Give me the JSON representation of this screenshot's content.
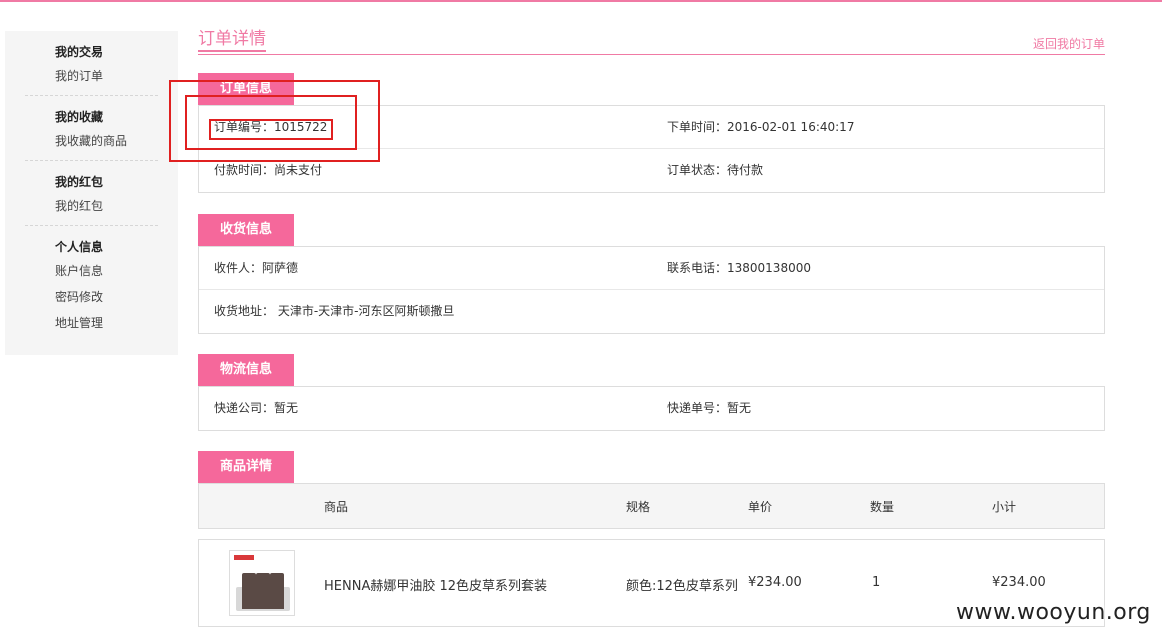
{
  "sidebar": {
    "groups": [
      {
        "title": "我的交易",
        "links": [
          "我的订单"
        ]
      },
      {
        "title": "我的收藏",
        "links": [
          "我收藏的商品"
        ]
      },
      {
        "title": "我的红包",
        "links": [
          "我的红包"
        ]
      },
      {
        "title": "个人信息",
        "links": [
          "账户信息",
          "密码修改",
          "地址管理"
        ]
      }
    ]
  },
  "header": {
    "title": "订单详情",
    "back_link": "返回我的订单"
  },
  "order_info": {
    "tab": "订单信息",
    "order_no": "订单编号：1015722",
    "order_time": "下单时间：2016-02-01 16:40:17",
    "pay_time": "付款时间：尚未支付",
    "status": "订单状态：待付款"
  },
  "shipping": {
    "tab": "收货信息",
    "receiver": "收件人：阿萨德",
    "phone": "联系电话：13800138000",
    "address": "收货地址： 天津市-天津市-河东区阿斯顿撒旦"
  },
  "logistics": {
    "tab": "物流信息",
    "company": "快递公司：暂无",
    "tracking": "快递单号：暂无"
  },
  "products": {
    "tab": "商品详情",
    "columns": [
      "商品",
      "规格",
      "单价",
      "数量",
      "小计"
    ],
    "items": [
      {
        "name": "HENNA赫娜甲油胶 12色皮草系列套装",
        "spec": "颜色:12色皮草系列",
        "price": "¥234.00",
        "qty": "1",
        "subtotal": "¥234.00"
      }
    ]
  },
  "watermark": "www.wooyun.org",
  "colors": {
    "accent": "#f07aa4",
    "tab_bg": "#f5689b",
    "highlight_box": "#e02020"
  }
}
